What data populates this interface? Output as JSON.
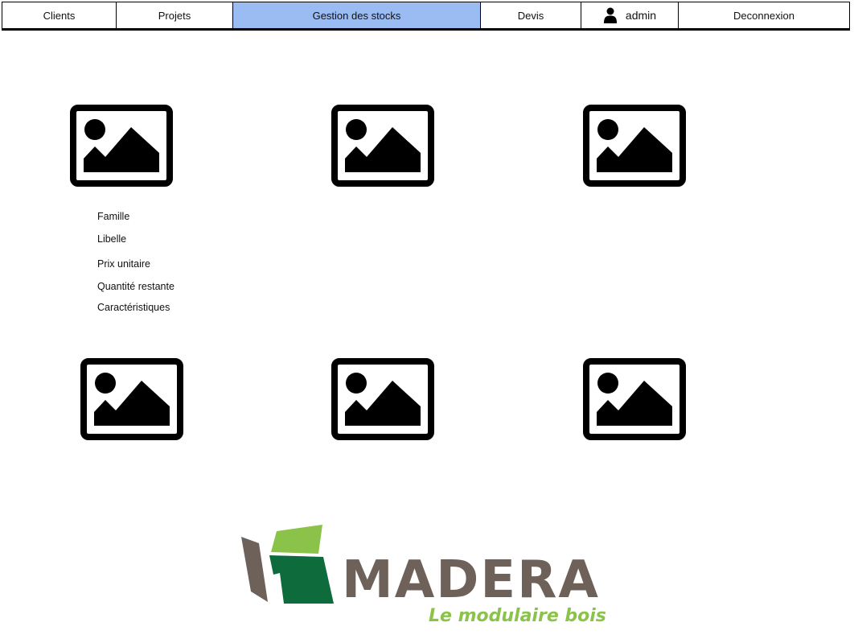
{
  "nav": {
    "items": [
      {
        "label": "Clients",
        "active": false
      },
      {
        "label": "Projets",
        "active": false
      },
      {
        "label": "Gestion des stocks",
        "active": true
      },
      {
        "label": "Devis",
        "active": false
      }
    ],
    "user_label": "admin",
    "user_icon": "user-icon",
    "logout_label": "Deconnexion",
    "active_color": "#9bbcf3"
  },
  "products": {
    "image_icon": "image-placeholder-icon",
    "count": 6,
    "details": {
      "famille": "Famille",
      "libelle": "Libelle",
      "prix": "Prix unitaire",
      "quantite": "Quantité restante",
      "caracteristiques": "Caractéristiques"
    }
  },
  "logo": {
    "name": "MADERA",
    "tagline": "Le modulaire bois",
    "colors": {
      "text": "#6d6159",
      "tagline": "#8bc34a",
      "dark_green": "#0e6b3b",
      "light_green": "#8bc34a",
      "brown": "#6d6159"
    }
  }
}
